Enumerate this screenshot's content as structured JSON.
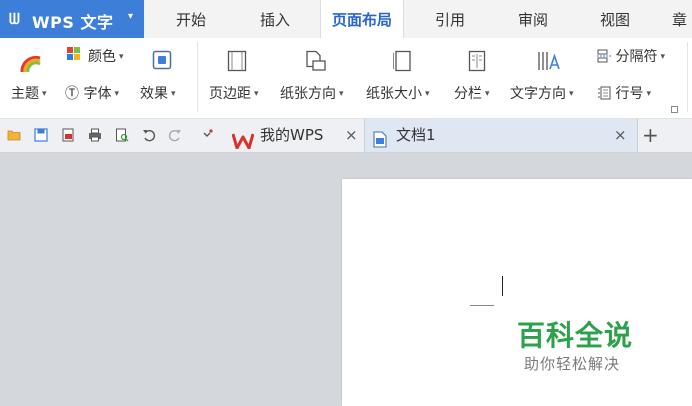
{
  "app": {
    "logo_glyph": "ᗯ",
    "title": "WPS 文字",
    "menu_caret": "▾"
  },
  "menu_tabs": [
    {
      "label": "开始"
    },
    {
      "label": "插入"
    },
    {
      "label": "页面布局",
      "active": true
    },
    {
      "label": "引用"
    },
    {
      "label": "审阅"
    },
    {
      "label": "视图"
    },
    {
      "label": "章"
    }
  ],
  "ribbon": {
    "theme": "主题",
    "color": "颜色",
    "font": "字体",
    "font_glyph": "Ⓣ",
    "effect": "效果",
    "margins": "页边距",
    "orientation": "纸张方向",
    "size": "纸张大小",
    "columns": "分栏",
    "text_direction": "文字方向",
    "breaks": "分隔符",
    "line_numbers": "行号",
    "dropdown": "▾"
  },
  "doc_tabs": [
    {
      "label": "我的WPS",
      "close": "×"
    },
    {
      "label": "文档1",
      "close": "×",
      "active": true
    }
  ],
  "new_tab": "+",
  "watermark": {
    "title": "百科全说",
    "subtitle": "助你轻松解决"
  },
  "colors": {
    "accent": "#3d7fd8",
    "active_tab_text": "#2b66c9",
    "watermark_green": "#2da04b",
    "wps_red": "#d9312b"
  }
}
